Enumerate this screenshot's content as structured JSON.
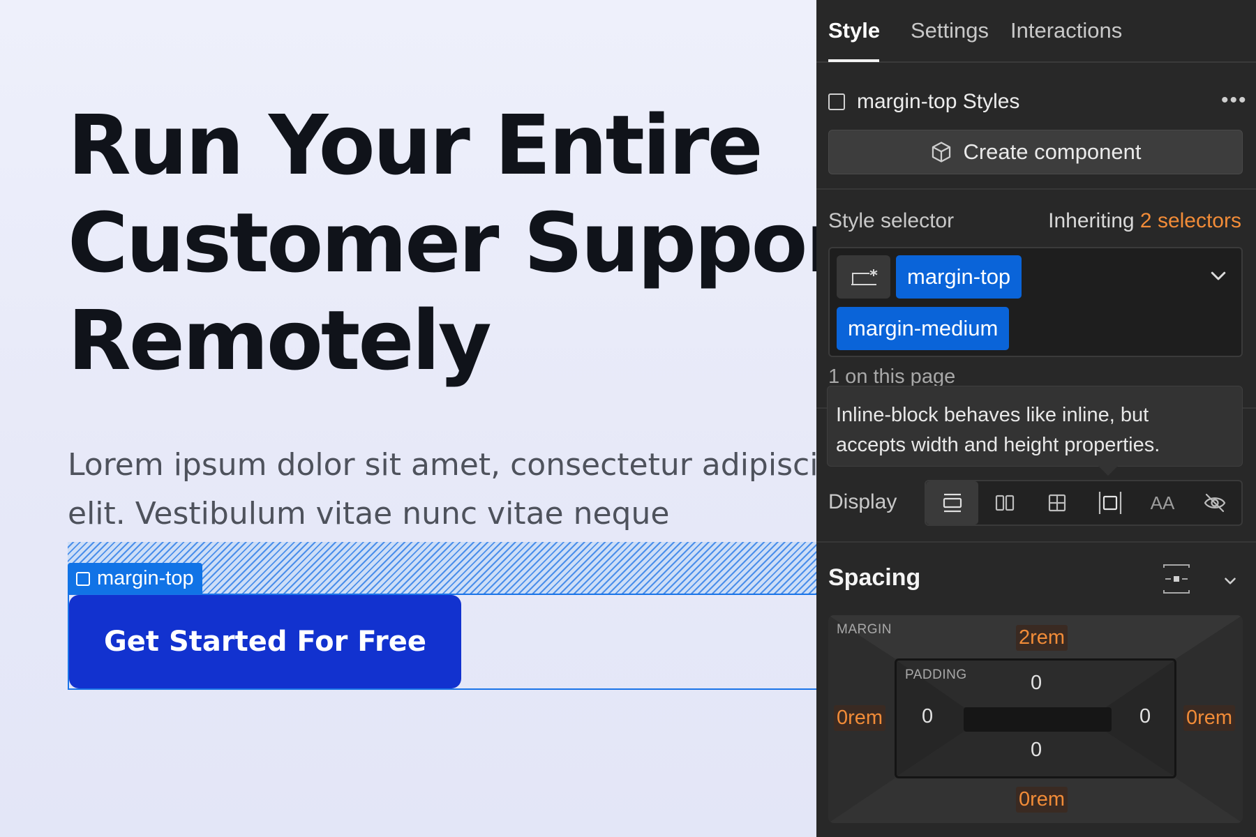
{
  "canvas": {
    "headline": [
      "Run Your Entire",
      "Customer Support",
      "Remotely"
    ],
    "subtext": [
      "Lorem ipsum dolor sit amet, consectetur adipiscing",
      "elit. Vestibulum vitae nunc vitae neque"
    ],
    "margin_tag": "margin-top",
    "cta_label": "Get Started For Free"
  },
  "panel": {
    "tabs": [
      "Style",
      "Settings",
      "Interactions"
    ],
    "active_tab": "Style",
    "styles_title": "margin-top Styles",
    "more_label": "•••",
    "create_component": "Create component",
    "style_selector": {
      "label": "Style selector",
      "inheriting_prefix": "Inheriting",
      "inheriting_count": "2 selectors",
      "chips": [
        "margin-top",
        "margin-medium"
      ],
      "on_page": "1 on this page"
    },
    "tooltip": [
      "Inline-block behaves like inline, but",
      "accepts width and height properties."
    ],
    "display": {
      "label": "Display",
      "options": [
        "block-icon",
        "flex-icon",
        "grid-icon",
        "inline-block-icon",
        "inline-text-icon",
        "hidden-icon"
      ],
      "inline_text_label": "AA",
      "selected": "block"
    },
    "spacing": {
      "title": "Spacing",
      "margin_label": "MARGIN",
      "padding_label": "PADDING",
      "margin": {
        "top": "2rem",
        "right": "0rem",
        "bottom": "0rem",
        "left": "0rem"
      },
      "padding": {
        "top": "0",
        "right": "0",
        "bottom": "0",
        "left": "0"
      }
    },
    "colors": {
      "accent": "#0a64d9",
      "inherit": "#f28c38",
      "panel_bg": "#282828",
      "cta": "#1232cf"
    }
  }
}
